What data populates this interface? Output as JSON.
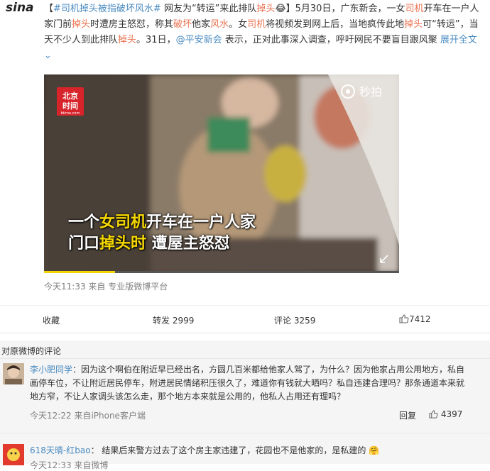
{
  "logo": {
    "text": "sina"
  },
  "post": {
    "parts": [
      {
        "t": "【",
        "c": ""
      },
      {
        "t": "#司机掉头被指破坏风水#",
        "c": "lnk"
      },
      {
        "t": " 网友为“转运”来此排队",
        "c": ""
      },
      {
        "t": "掉头",
        "c": "hl"
      },
      {
        "t": "😂",
        "c": ""
      },
      {
        "t": "】5月30日，广东新会，一女",
        "c": ""
      },
      {
        "t": "司机",
        "c": "hl"
      },
      {
        "t": "开车在一户人家门前",
        "c": ""
      },
      {
        "t": "掉头",
        "c": "hl"
      },
      {
        "t": "时遭房主怒怼，称其",
        "c": ""
      },
      {
        "t": "破坏",
        "c": "hl"
      },
      {
        "t": "他家",
        "c": ""
      },
      {
        "t": "风水",
        "c": "hl"
      },
      {
        "t": "。女",
        "c": ""
      },
      {
        "t": "司机",
        "c": "hl"
      },
      {
        "t": "将视频发到网上后，当地疯传此地",
        "c": ""
      },
      {
        "t": "掉头",
        "c": "hl"
      },
      {
        "t": "可“转运”，当天不少人到此排队",
        "c": ""
      },
      {
        "t": "掉头",
        "c": "hl"
      },
      {
        "t": "。31日，",
        "c": ""
      },
      {
        "t": "@平安新会",
        "c": "lnk"
      },
      {
        "t": " 表示，正对此事深入调查，呼吁网民不要盲目跟风聚 ",
        "c": ""
      },
      {
        "t": "展开全文⌄",
        "c": "lnk"
      }
    ]
  },
  "video": {
    "source_logo_main": "北京",
    "source_logo_sub": "时间",
    "source_logo_url": "btime.com",
    "platform_logo": "秒拍",
    "caption_line1_a": "一个",
    "caption_line1_b": "女司机",
    "caption_line1_c": "开车在一户人家",
    "caption_line2_a": "门口",
    "caption_line2_b": "掉头时",
    "caption_line2_c": " 遭屋主怒怼",
    "progress": 0.2
  },
  "meta": {
    "time": "今天11:33",
    "from": "来自",
    "source": "专业版微博平台"
  },
  "actions": {
    "favorite": "收藏",
    "repost": "转发 2999",
    "comment": "评论 3259",
    "likes": "7412"
  },
  "comments_header": "对原微博的评论",
  "comments": [
    {
      "user": "李小肥同学",
      "text": "：因为这个啊伯在附近早已经出名，方圆几百米都给他家人驾了，为什么？因为他家占用公用地方，私自画停车位，不让附近居民停车，附进居民情绪积压很久了，难道你有钱就大晒吗？私自违建合理吗？那条通道本来就地方窄，不让人家调头该怎么走，那个地方本来就是公用的，他私人占用还有理吗？",
      "time": "今天12:22",
      "from": "来自",
      "source": "iPhone客户端",
      "reply": "回复",
      "likes": "4397"
    },
    {
      "user": "618天晴-红bao",
      "text": "： 结果后来警方过去了这个房主家违建了，花园也不是他家的，是私建的",
      "emoji": "🤗",
      "time": "今天12:33",
      "source": "来自微博"
    }
  ],
  "colors": {
    "accent": "#eb7350",
    "link": "#4a8bc1",
    "meta": "#808080"
  }
}
